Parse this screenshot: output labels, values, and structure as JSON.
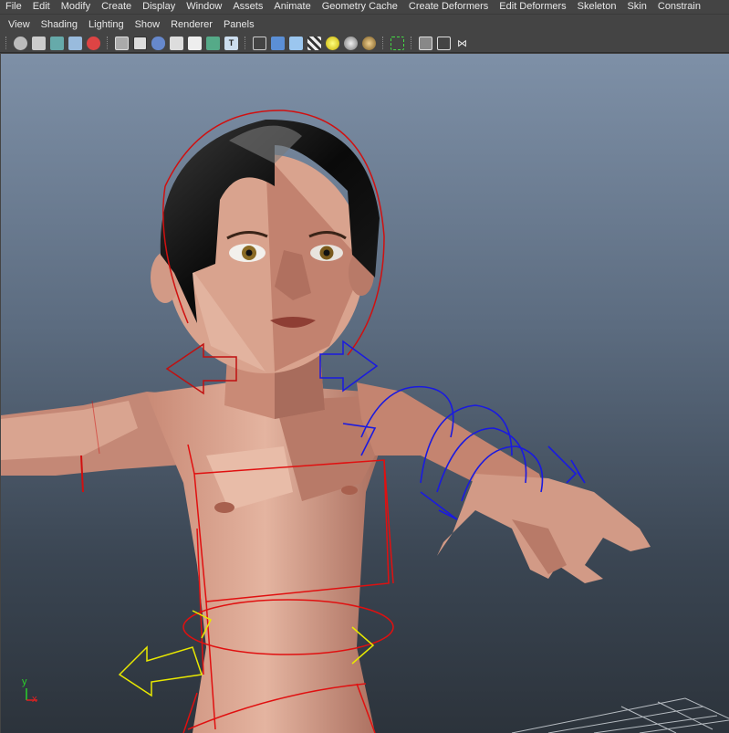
{
  "menu": [
    "File",
    "Edit",
    "Modify",
    "Create",
    "Display",
    "Window",
    "Assets",
    "Animate",
    "Geometry Cache",
    "Create Deformers",
    "Edit Deformers",
    "Skeleton",
    "Skin",
    "Constrain"
  ],
  "panel_menu": [
    "View",
    "Shading",
    "Lighting",
    "Show",
    "Renderer",
    "Panels"
  ],
  "toolbar_icons": [
    "camera-icon",
    "camera-attributes-icon",
    "bookmark-icon",
    "image-plane-icon",
    "grease-pencil-icon",
    "grid-icon",
    "film-gate-icon",
    "resolution-gate-icon",
    "safe-frame-icon",
    "field-chart-icon",
    "isolate-select-icon",
    "text-icon",
    "wireframe-icon",
    "smooth-shade-icon",
    "textured-icon",
    "xray-icon",
    "default-light-icon",
    "shadow-icon",
    "ambient-occlusion-icon",
    "select-highlight-icon",
    "wireframe-on-shaded-icon",
    "isolate-icon",
    "hierarchy-icon"
  ],
  "axis": {
    "y": "y",
    "x": "x"
  },
  "colors": {
    "menubar": "#444444",
    "viewport_top": "#7e90a7",
    "viewport_bottom": "#2c333b",
    "rig_red": "#d01010",
    "rig_blue": "#1a1ae0",
    "rig_yellow": "#e8e800",
    "skin": "#d9a08c"
  }
}
